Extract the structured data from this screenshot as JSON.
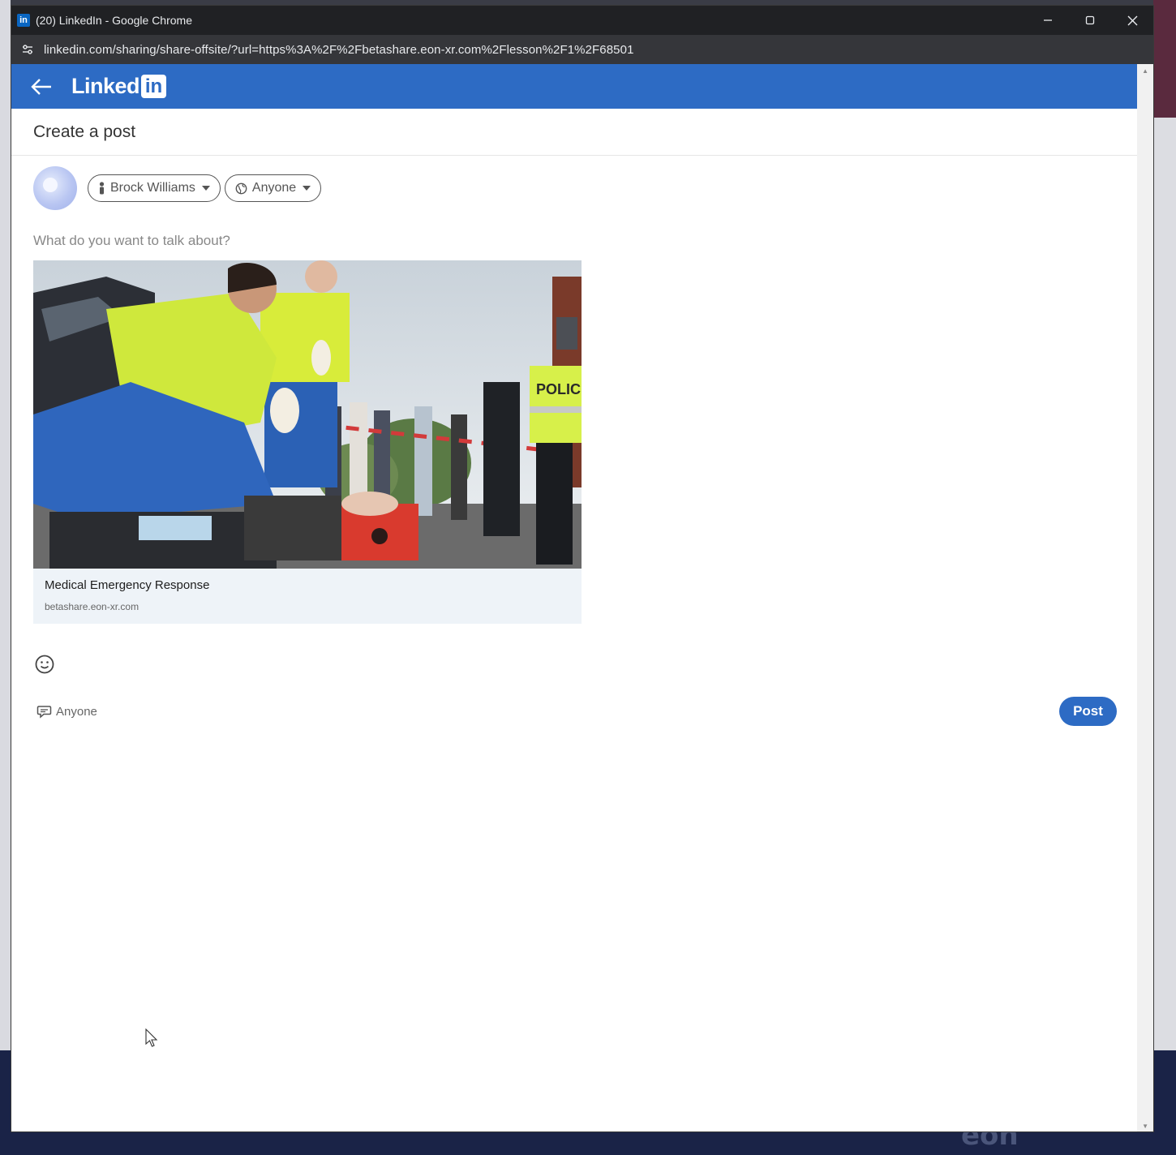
{
  "window": {
    "tab_title": "(20) LinkedIn - Google Chrome",
    "favicon_text": "in",
    "url": "linkedin.com/sharing/share-offsite/?url=https%3A%2F%2Fbetashare.eon-xr.com%2Flesson%2F1%2F68501"
  },
  "header": {
    "logo_text": "Linked",
    "logo_box_text": "in",
    "brand_color": "#2d6bc4"
  },
  "post": {
    "title": "Create a post",
    "author_name": "Brock Williams",
    "visibility": "Anyone",
    "placeholder": "What do you want to talk about?"
  },
  "preview": {
    "title": "Medical Emergency Response",
    "domain": "betashare.eon-xr.com",
    "vest_text": "POLIC"
  },
  "footer": {
    "comment_permission": "Anyone",
    "post_label": "Post"
  },
  "background": {
    "logo_text": "eon"
  }
}
